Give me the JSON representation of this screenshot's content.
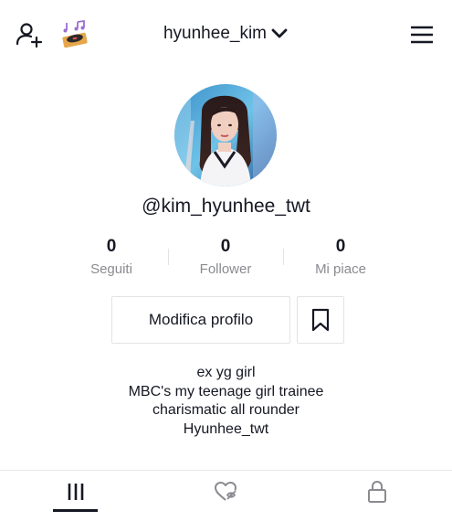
{
  "header": {
    "username": "hyunhee_kim",
    "icons": {
      "add_user": "add-user-icon",
      "music": "music-record-player-icon",
      "username_dropdown": "chevron-down-icon",
      "menu": "hamburger-menu-icon"
    }
  },
  "profile": {
    "handle": "@kim_hyunhee_twt"
  },
  "stats": [
    {
      "value": "0",
      "label": "Seguiti"
    },
    {
      "value": "0",
      "label": "Follower"
    },
    {
      "value": "0",
      "label": "Mi piace"
    }
  ],
  "actions": {
    "edit_profile_label": "Modifica profilo",
    "bookmark_icon": "bookmark-icon"
  },
  "bio": [
    "ex yg girl",
    "MBC's my teenage girl trainee",
    "charismatic all rounder",
    "Hyunhee_twt"
  ],
  "tabs": [
    {
      "icon": "grid-videos-icon",
      "active": true
    },
    {
      "icon": "liked-hidden-icon",
      "active": false
    },
    {
      "icon": "lock-icon",
      "active": false
    }
  ],
  "colors": {
    "text": "#161823",
    "muted": "#8a8b91",
    "border": "#e3e3e4"
  }
}
